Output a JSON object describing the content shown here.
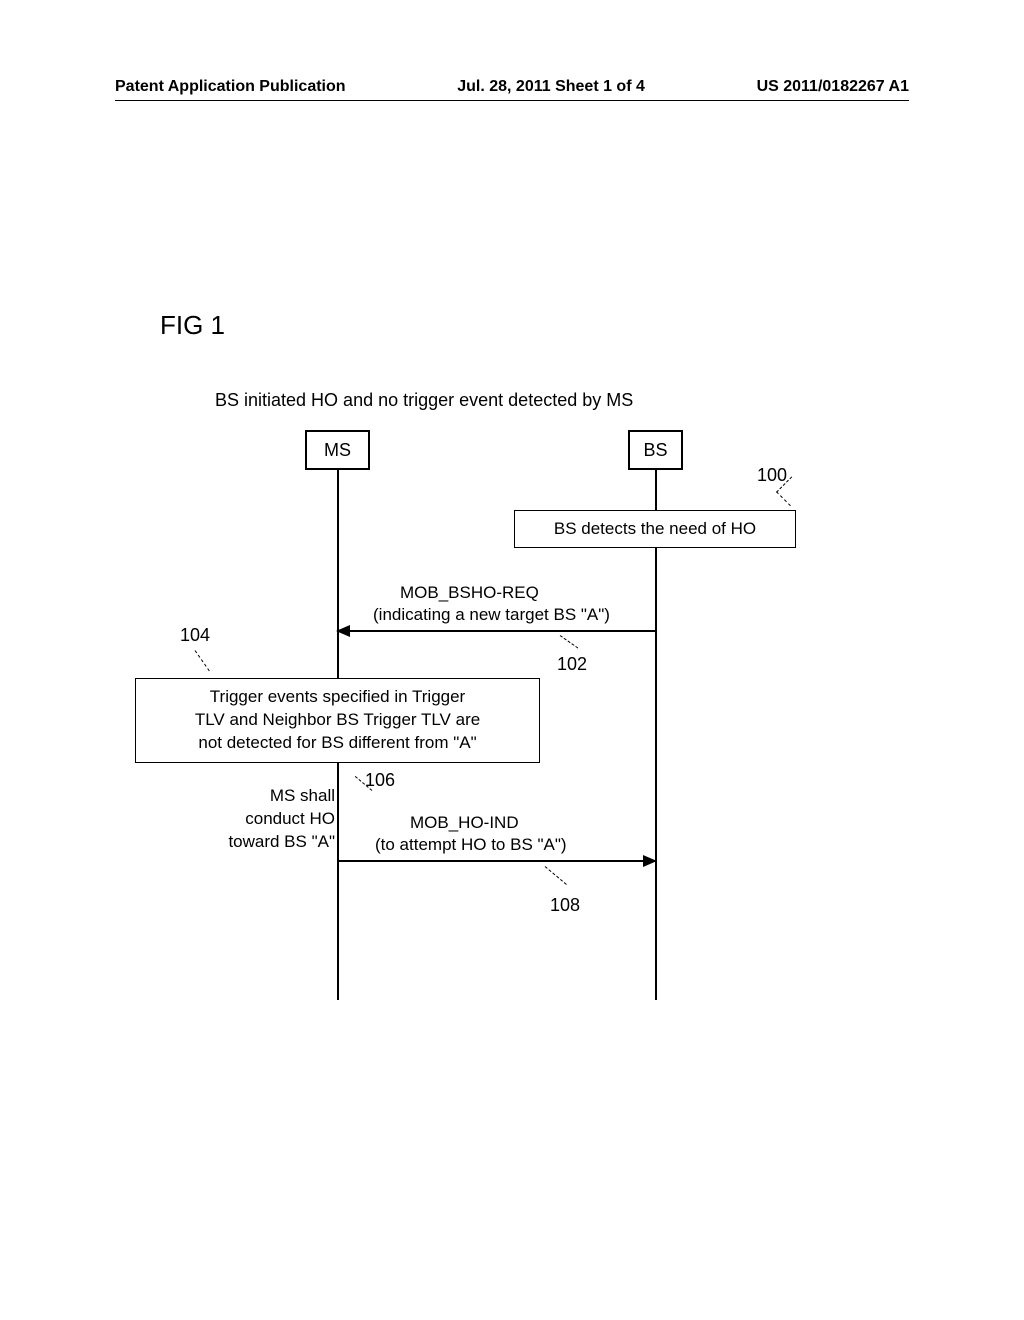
{
  "header": {
    "left": "Patent Application Publication",
    "center": "Jul. 28, 2011  Sheet 1 of 4",
    "right": "US 2011/0182267 A1"
  },
  "figure_label": "FIG 1",
  "diagram_title": "BS initiated HO and no trigger event detected by MS",
  "ms_label": "MS",
  "bs_label": "BS",
  "bs_detects": "BS detects the need of HO",
  "ref_100": "100",
  "ref_102": "102",
  "ref_104": "104",
  "ref_106": "106",
  "ref_108": "108",
  "msg_102_line1": "MOB_BSHO-REQ",
  "msg_102_line2": "(indicating a new target BS \"A\")",
  "trigger_box_line1": "Trigger events specified in Trigger",
  "trigger_box_line2": "TLV and Neighbor BS Trigger TLV are",
  "trigger_box_line3": "not detected for BS different from \"A\"",
  "ms_shall_line1": "MS shall",
  "ms_shall_line2": "conduct HO",
  "ms_shall_line3": "toward BS \"A\"",
  "msg_108_line1": "MOB_HO-IND",
  "msg_108_line2": "(to attempt HO to BS \"A\")"
}
